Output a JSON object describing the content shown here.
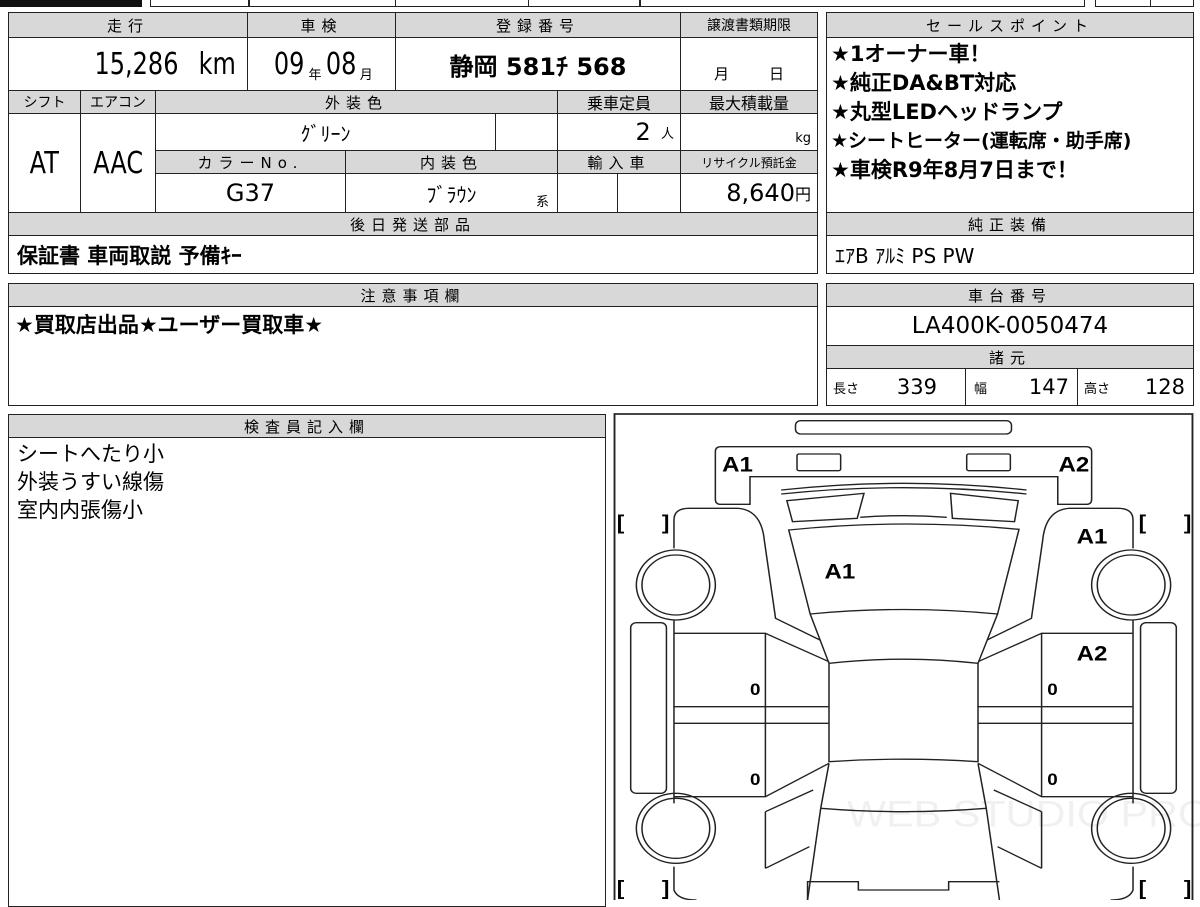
{
  "mileage": {
    "label": "走行",
    "value": "15,286",
    "unit": "km"
  },
  "inspection": {
    "label": "車検",
    "year": "09",
    "year_unit": "年",
    "month": "08",
    "month_unit": "月"
  },
  "registration": {
    "label": "登録番号",
    "value": "静岡 581ﾁ 568"
  },
  "transfer_docs": {
    "label": "譲渡書類期限",
    "month_unit": "月",
    "day_unit": "日"
  },
  "shift": {
    "label": "シフト",
    "value": "AT"
  },
  "aircon": {
    "label": "エアコン",
    "value": "AAC"
  },
  "exterior_color": {
    "label": "外装色",
    "value": "ｸﾞﾘｰﾝ"
  },
  "capacity": {
    "label": "乗車定員",
    "value": "2",
    "unit": "人"
  },
  "max_load": {
    "label": "最大積載量",
    "unit": "kg"
  },
  "color_no": {
    "label": "カラーNo.",
    "value": "G37"
  },
  "interior_color": {
    "label": "内装色",
    "value": "ﾌﾞﾗｳﾝ",
    "suffix": "系"
  },
  "imported": {
    "label": "輸入車"
  },
  "recycle_fee": {
    "label": "リサイクル預託金",
    "value": "8,640",
    "unit": "円"
  },
  "later_parts": {
    "label": "後日発送部品",
    "value": "保証書 車両取説 予備ｷｰ"
  },
  "sales_points": {
    "label": "セールスポイント",
    "items": [
      "★1オーナー車！",
      "★純正DA&BT対応",
      "★丸型LEDヘッドランプ",
      "★シートヒーター(運転席・助手席)",
      "★車検R9年8月7日まで！"
    ]
  },
  "equipment": {
    "label": "純正装備",
    "value": "ｴｱB ｱﾙﾐ PS PW"
  },
  "notes": {
    "label": "注意事項欄",
    "value": "★買取店出品★ユーザー買取車★"
  },
  "chassis": {
    "label": "車台番号",
    "value": "LA400K-0050474"
  },
  "specs": {
    "label": "諸元",
    "length_label": "長さ",
    "length": "339",
    "width_label": "幅",
    "width": "147",
    "height_label": "高さ",
    "height": "128"
  },
  "inspector": {
    "label": "検査員記入欄",
    "lines": [
      "シートへたり小",
      "外装うすい線傷",
      "室内内張傷小"
    ]
  },
  "diagram": {
    "marks": {
      "rear_left": "A1",
      "rear_right": "A2",
      "rear_glass": "A1",
      "right_rear_quarter": "A1",
      "right_rear_door": "A2",
      "left_rear_door": "0",
      "left_front_door": "0",
      "right_rear_door_num": "0",
      "right_front_door": "0"
    },
    "bracket_open": "[",
    "bracket_close": "]",
    "watermark": "WEB STUDIO PRO"
  }
}
